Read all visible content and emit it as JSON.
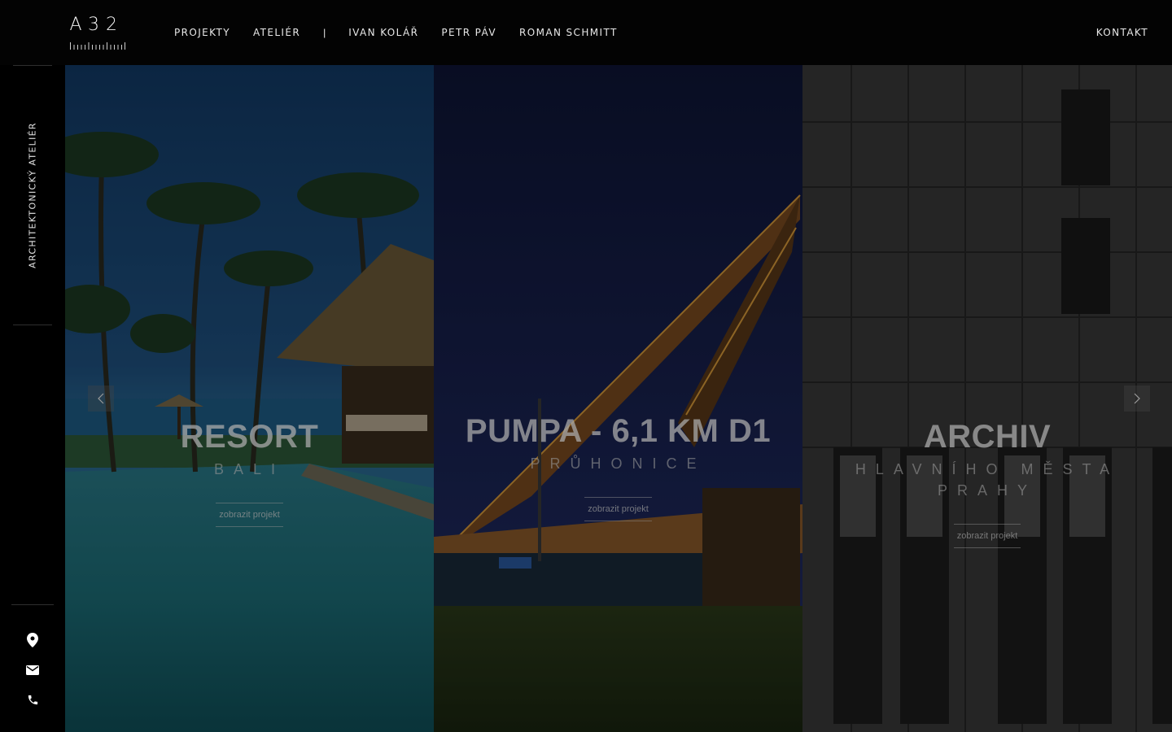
{
  "header": {
    "logo": {
      "chars": [
        "A",
        "3",
        "2"
      ]
    },
    "nav": [
      {
        "label": "PROJEKTY"
      },
      {
        "label": "ATELIÉR"
      },
      {
        "label": "|"
      },
      {
        "label": "IVAN KOLÁŘ"
      },
      {
        "label": "PETR PÁV"
      },
      {
        "label": "ROMAN SCHMITT"
      }
    ],
    "contact_label": "KONTAKT"
  },
  "sidebar": {
    "vertical_label": "ARCHITEKTONICKÝ ATELIÉR",
    "icons": [
      "location-pin-icon",
      "envelope-icon",
      "phone-icon"
    ]
  },
  "slider": {
    "prev_icon": "chevron-left-icon",
    "next_icon": "chevron-right-icon",
    "panels": [
      {
        "title": "RESORT",
        "subtitle": "BALI",
        "button": "zobrazit projekt"
      },
      {
        "title": "PUMPA - 6,1 KM D1",
        "subtitle": "PRŮHONICE",
        "button": "zobrazit projekt"
      },
      {
        "title": "ARCHIV",
        "subtitle": "HLAVNÍHO MĚSTA PRAHY",
        "button": "zobrazit projekt"
      }
    ]
  },
  "colors": {
    "background": "#000000",
    "header": "#030303",
    "text": "#e8e8e8"
  }
}
